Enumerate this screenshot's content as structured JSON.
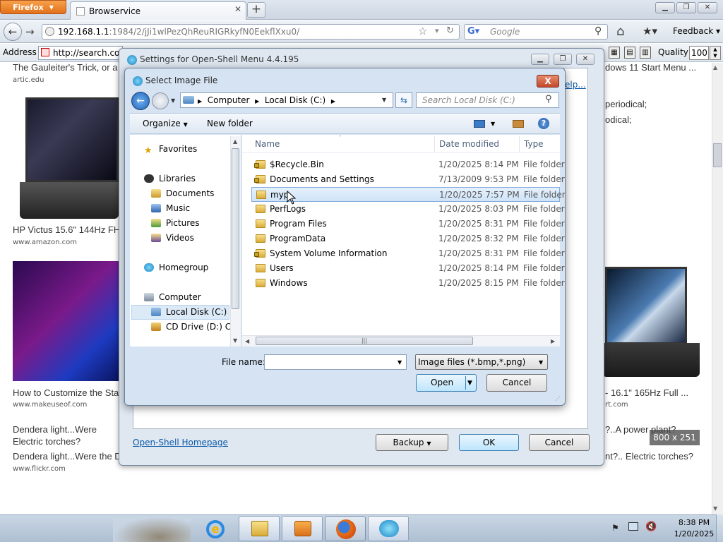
{
  "browser": {
    "app_button": "Firefox",
    "tab_title": "Browservice",
    "new_tab": "+",
    "url_host": "192.168.1.1",
    "url_rest": ":1984/2/jJi1wlPezQhReuRIGRkyfN0EekflXxu0/",
    "search_placeholder": "Google",
    "feedback_label": "Feedback",
    "address_label": "Address",
    "address_value": "http://search.coll",
    "quality_label": "Quality",
    "quality_value": "100"
  },
  "webpage": {
    "left_items": [
      {
        "title": "The Gauleiter's Trick, or a",
        "source": "artic.edu"
      },
      {
        "title": "HP Victus 15.6\" 144Hz FH",
        "source": "www.amazon.com"
      },
      {
        "title": "How to Customize the Sta",
        "source": "www.makeuseof.com"
      },
      {
        "title": "Dendera light...Were",
        "title2": "Electric torches?",
        "caption": "Dendera light...Were the D",
        "source": "www.flickr.com"
      }
    ],
    "right_items": [
      {
        "title": "dows 11 Start Menu ..."
      },
      {
        "title": "periodical;"
      },
      {
        "title": "odical;"
      },
      {
        "title": "- 16.1\" 165Hz Full ...",
        "source": "rt.com"
      },
      {
        "title": "?..A power plant?"
      },
      {
        "title": "nt?.. Electric torches?"
      }
    ],
    "help_link": "elp...",
    "image_size_badge": "800 x 251"
  },
  "settings_window": {
    "title": "Settings for Open-Shell Menu 4.4.195",
    "homepage_link": "Open-Shell Homepage",
    "backup_label": "Backup",
    "ok_label": "OK",
    "cancel_label": "Cancel"
  },
  "file_dialog": {
    "title": "Select Image File",
    "close": "X",
    "breadcrumb": [
      "Computer",
      "Local Disk (C:)"
    ],
    "search_placeholder": "Search Local Disk (C:)",
    "organize_label": "Organize",
    "new_folder_label": "New folder",
    "help": "?",
    "nav": {
      "favorites": "Favorites",
      "libraries": "Libraries",
      "documents": "Documents",
      "music": "Music",
      "pictures": "Pictures",
      "videos": "Videos",
      "homegroup": "Homegroup",
      "computer": "Computer",
      "local_disk": "Local Disk (C:)",
      "cd_drive": "CD Drive (D:) CDI"
    },
    "columns": {
      "name": "Name",
      "date": "Date modified",
      "type": "Type"
    },
    "files": [
      {
        "name": "$Recycle.Bin",
        "date": "1/20/2025 8:14 PM",
        "type": "File folder",
        "locked": true
      },
      {
        "name": "Documents and Settings",
        "date": "7/13/2009 9:53 PM",
        "type": "File folder",
        "locked": true
      },
      {
        "name": "myp",
        "date": "1/20/2025 7:57 PM",
        "type": "File folder",
        "locked": false,
        "selected": true
      },
      {
        "name": "PerfLogs",
        "date": "1/20/2025 8:03 PM",
        "type": "File folder",
        "locked": false
      },
      {
        "name": "Program Files",
        "date": "1/20/2025 8:31 PM",
        "type": "File folder",
        "locked": false
      },
      {
        "name": "ProgramData",
        "date": "1/20/2025 8:32 PM",
        "type": "File folder",
        "locked": false
      },
      {
        "name": "System Volume Information",
        "date": "1/20/2025 8:31 PM",
        "type": "File folder",
        "locked": true
      },
      {
        "name": "Users",
        "date": "1/20/2025 8:14 PM",
        "type": "File folder",
        "locked": false
      },
      {
        "name": "Windows",
        "date": "1/20/2025 8:15 PM",
        "type": "File folder",
        "locked": false
      }
    ],
    "filename_label": "File name:",
    "filename_value": "",
    "filetype_value": "Image files (*.bmp,*.png)",
    "open_label": "Open",
    "cancel_label": "Cancel"
  },
  "taskbar": {
    "time": "8:38 PM",
    "date": "1/20/2025",
    "apps": [
      "ie-icon",
      "windows-explorer-icon",
      "media-player-icon",
      "firefox-icon",
      "open-shell-icon"
    ]
  },
  "colors": {
    "window_frame": "#dfe7f1",
    "dialog_frame": "#d5e3f3",
    "selection": "#cfe4f8",
    "link": "#0a5aa8",
    "close_red": "#c44a2a"
  }
}
